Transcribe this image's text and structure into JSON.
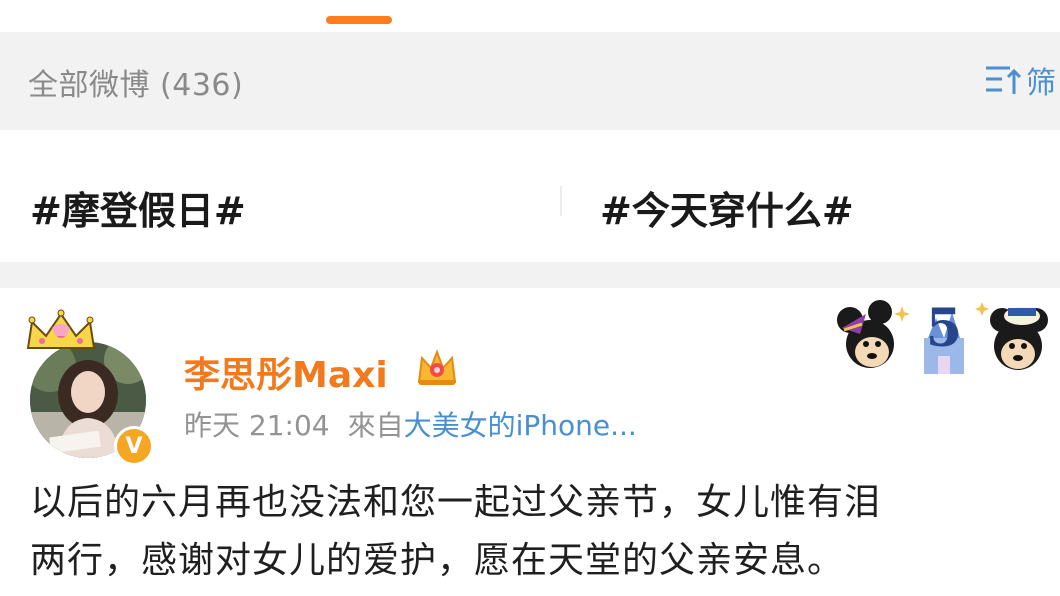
{
  "header": {
    "weibo_count_label": "全部微博 (436)",
    "filter_label": "筛"
  },
  "topics": [
    {
      "label": "#摩登假日#"
    },
    {
      "label": "#今天穿什么#"
    }
  ],
  "post": {
    "username": "李思彤Maxi",
    "time": "昨天 21:04",
    "source_prefix": "來自",
    "source_name": "大美女的iPhone...",
    "text_lines": [
      "以后的六月再也没法和您一起过父亲节，女儿惟有泪",
      "两行，感谢对女儿的爱护，愿在天堂的父亲安息。"
    ]
  },
  "icons": {
    "filter": "filter-sort-icon",
    "verified": "verified-v-icon",
    "vip": "vip-crown-icon",
    "avatar_frame": "pink-crown-frame-icon",
    "sticker": "disney-5-anniversary-sticker"
  },
  "colors": {
    "accent_orange": "#ff7d1a",
    "username_orange": "#f27a1e",
    "link_blue": "#4a8fd0",
    "badge_gold": "#f5a623",
    "bg_gray": "#f2f2f2"
  }
}
